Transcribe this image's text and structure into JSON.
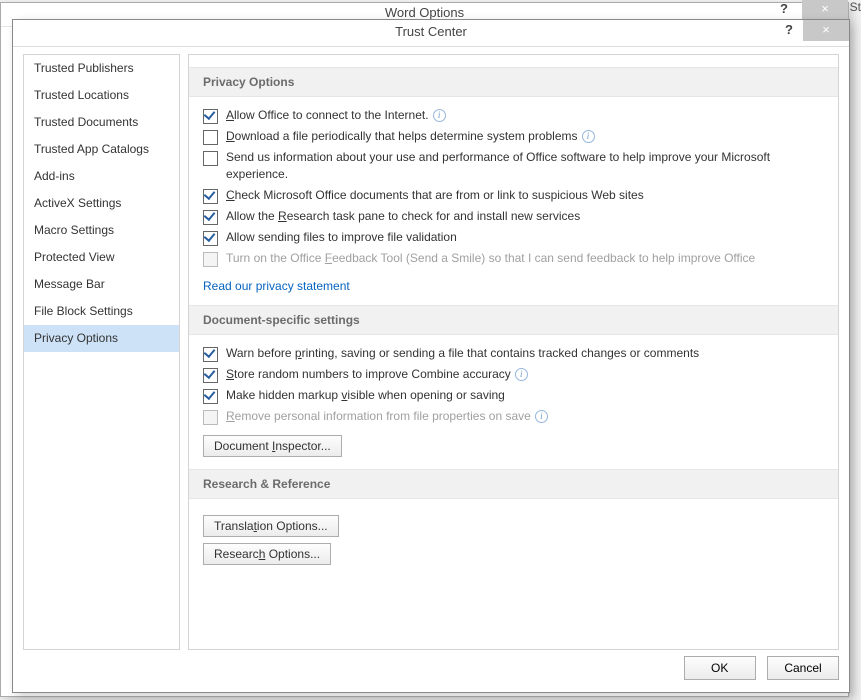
{
  "parent": {
    "title": "Word Options",
    "rt": "St"
  },
  "dialog": {
    "title": "Trust Center",
    "ok": "OK",
    "cancel": "Cancel"
  },
  "sidebar": {
    "items": [
      "Trusted Publishers",
      "Trusted Locations",
      "Trusted Documents",
      "Trusted App Catalogs",
      "Add-ins",
      "ActiveX Settings",
      "Macro Settings",
      "Protected View",
      "Message Bar",
      "File Block Settings",
      "Privacy Options"
    ],
    "selectedIndex": 10
  },
  "sections": {
    "privacy": {
      "header": "Privacy Options",
      "opts": [
        {
          "checked": true,
          "disabled": false,
          "info": true,
          "pre": "",
          "u": "A",
          "post": "llow Office to connect to the Internet."
        },
        {
          "checked": false,
          "disabled": false,
          "info": true,
          "pre": "",
          "u": "D",
          "post": "ownload a file periodically that helps determine system problems"
        },
        {
          "checked": false,
          "disabled": false,
          "info": false,
          "pre": "",
          "u": "",
          "post": "Send us information about your use and performance of Office software to help improve your Microsoft experience."
        },
        {
          "checked": true,
          "disabled": false,
          "info": false,
          "pre": "",
          "u": "C",
          "post": "heck Microsoft Office documents that are from or link to suspicious Web sites"
        },
        {
          "checked": true,
          "disabled": false,
          "info": false,
          "pre": "Allow the ",
          "u": "R",
          "post": "esearch task pane to check for and install new services"
        },
        {
          "checked": true,
          "disabled": false,
          "info": false,
          "pre": "",
          "u": "",
          "post": "Allow sending files to improve file validation"
        },
        {
          "checked": false,
          "disabled": true,
          "info": false,
          "pre": "Turn on the Office ",
          "u": "F",
          "post": "eedback Tool (Send a Smile) so that I can send feedback to help improve Office"
        }
      ],
      "link": "Read our privacy statement"
    },
    "doc": {
      "header": "Document-specific settings",
      "opts": [
        {
          "checked": true,
          "disabled": false,
          "info": false,
          "pre": "Warn before ",
          "u": "p",
          "post": "rinting, saving or sending a file that contains tracked changes or comments"
        },
        {
          "checked": true,
          "disabled": false,
          "info": true,
          "pre": "",
          "u": "S",
          "post": "tore random numbers to improve Combine accuracy"
        },
        {
          "checked": true,
          "disabled": false,
          "info": false,
          "pre": "Make hidden markup ",
          "u": "v",
          "post": "isible when opening or saving"
        },
        {
          "checked": false,
          "disabled": true,
          "info": true,
          "pre": "",
          "u": "R",
          "post": "emove personal information from file properties on save"
        }
      ],
      "btn_pre": "Document ",
      "btn_u": "I",
      "btn_post": "nspector..."
    },
    "research": {
      "header": "Research & Reference",
      "btn1_pre": "Transla",
      "btn1_u": "t",
      "btn1_post": "ion Options...",
      "btn2_pre": "Researc",
      "btn2_u": "h",
      "btn2_post": " Options..."
    }
  }
}
